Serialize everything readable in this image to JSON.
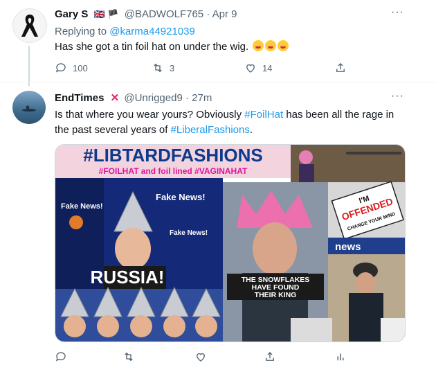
{
  "tweet1": {
    "name": "Gary S",
    "flags": "🇬🇧 🏴",
    "handle": "@BADWOLF765",
    "separator": "·",
    "date": "Apr 9",
    "replying_prefix": "Replying to ",
    "replying_handle": "@karma44921039",
    "text": "Has she got a tin foil hat on under the wig.",
    "emoji_name": "zany-face-emoji",
    "reply_count": "100",
    "retweet_count": "3",
    "like_count": "14"
  },
  "tweet2": {
    "name": "EndTimes",
    "flag": "✕",
    "handle": "@Unrigged9",
    "separator": "·",
    "date": "27m",
    "text_line1_pre": "Is that where you wear yours?  Obviously ",
    "hashtag1": "#FoilHat",
    "text_line1_post": " has been all the rage in",
    "text_line2_pre": "the past several years of ",
    "hashtag2": "#LiberalFashions",
    "text_line2_post": "."
  },
  "meme": {
    "title": "#LIBTARDFASHIONS",
    "subtitle": "#FOILHAT and foil lined #VAGINAHAT",
    "fake_news_1": "Fake News!",
    "fake_news_2": "Fake News!",
    "fake_news_3": "Fake News!",
    "russia": "RUSSIA!",
    "sign_line1": "I'M",
    "sign_line2": "OFFENDED",
    "sign_line3": "CHANGE YOUR MIND",
    "news": "news",
    "snowflake_line1": "THE SNOWFLAKES",
    "snowflake_line2": "HAVE FOUND",
    "snowflake_line3": "THEIR KING"
  },
  "more_glyph": "···",
  "colors": {
    "accent": "#1d9bf0",
    "secondary_text": "#536471",
    "title_blue": "#0b3a8c",
    "subtitle_pink": "#e0149a"
  }
}
